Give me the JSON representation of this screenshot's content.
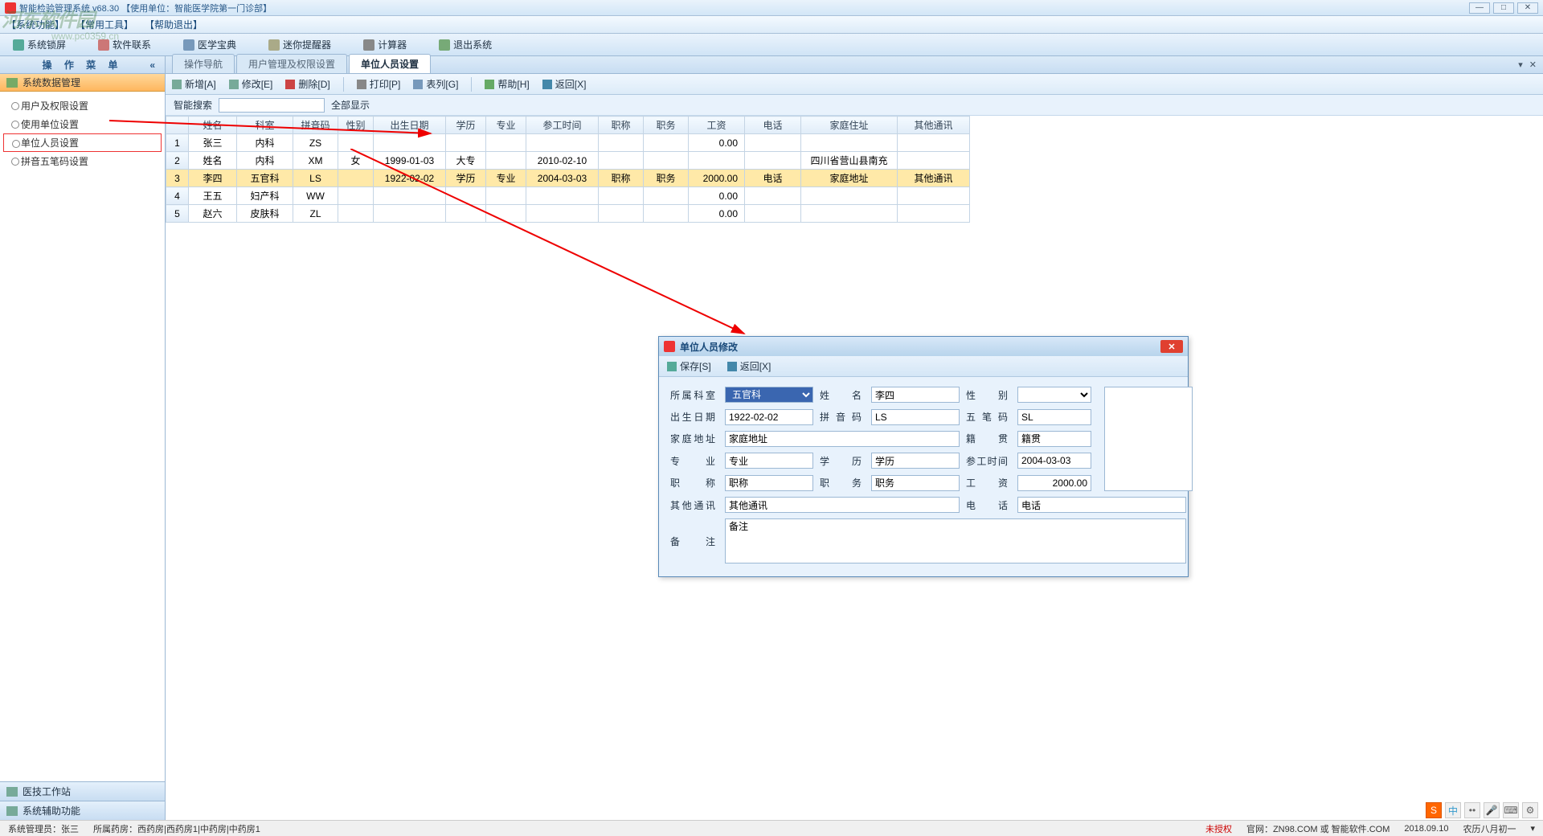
{
  "titlebar": {
    "text": "智能检验管理系统 v68.30   【使用单位：智能医学院第一门诊部】"
  },
  "menubar": {
    "items": [
      "【系统功能】",
      "【常用工具】",
      "【帮助退出】"
    ]
  },
  "maintoolbar": {
    "items": [
      "系统锁屏",
      "软件联系",
      "医学宝典",
      "迷你提醒器",
      "计算器",
      "退出系统"
    ]
  },
  "sidebar": {
    "header": "操 作 菜 单",
    "section": "系统数据管理",
    "tree": [
      "用户及权限设置",
      "使用单位设置",
      "单位人员设置",
      "拼音五笔码设置"
    ],
    "selected_index": 2,
    "bottom": [
      "医技工作站",
      "系统辅助功能"
    ]
  },
  "tabs": {
    "items": [
      "操作导航",
      "用户管理及权限设置",
      "单位人员设置"
    ],
    "active": 2
  },
  "subtoolbar": {
    "items": [
      "新增[A]",
      "修改[E]",
      "删除[D]",
      "打印[P]",
      "表列[G]",
      "帮助[H]",
      "返回[X]"
    ]
  },
  "search": {
    "label": "智能搜索",
    "value": "",
    "show_all": "全部显示"
  },
  "table": {
    "headers": [
      "",
      "姓名",
      "科室",
      "拼音码",
      "性别",
      "出生日期",
      "学历",
      "专业",
      "参工时间",
      "职称",
      "职务",
      "工资",
      "电话",
      "家庭住址",
      "其他通讯"
    ],
    "rows": [
      {
        "n": "1",
        "name": "张三",
        "dept": "内科",
        "py": "ZS",
        "sex": "",
        "birth": "",
        "edu": "",
        "spec": "",
        "work": "",
        "title": "",
        "duty": "",
        "salary": "0.00",
        "tel": "",
        "addr": "",
        "other": ""
      },
      {
        "n": "2",
        "name": "姓名",
        "dept": "内科",
        "py": "XM",
        "sex": "女",
        "birth": "1999-01-03",
        "edu": "大专",
        "spec": "",
        "work": "2010-02-10",
        "title": "",
        "duty": "",
        "salary": "",
        "tel": "",
        "addr": "四川省营山县南充",
        "other": ""
      },
      {
        "n": "3",
        "name": "李四",
        "dept": "五官科",
        "py": "LS",
        "sex": "",
        "birth": "1922-02-02",
        "edu": "学历",
        "spec": "专业",
        "work": "2004-03-03",
        "title": "职称",
        "duty": "职务",
        "salary": "2000.00",
        "tel": "电话",
        "addr": "家庭地址",
        "other": "其他通讯"
      },
      {
        "n": "4",
        "name": "王五",
        "dept": "妇产科",
        "py": "WW",
        "sex": "",
        "birth": "",
        "edu": "",
        "spec": "",
        "work": "",
        "title": "",
        "duty": "",
        "salary": "0.00",
        "tel": "",
        "addr": "",
        "other": ""
      },
      {
        "n": "5",
        "name": "赵六",
        "dept": "皮肤科",
        "py": "ZL",
        "sex": "",
        "birth": "",
        "edu": "",
        "spec": "",
        "work": "",
        "title": "",
        "duty": "",
        "salary": "0.00",
        "tel": "",
        "addr": "",
        "other": ""
      }
    ],
    "selected_row": 2
  },
  "dialog": {
    "title": "单位人员修改",
    "toolbar": [
      "保存[S]",
      "返回[X]"
    ],
    "labels": {
      "dept": "所属科室",
      "name": "姓 名",
      "sex": "性 别",
      "birth": "出生日期",
      "py": "拼 音 码",
      "wb": "五 笔 码",
      "addr": "家庭地址",
      "native": "籍 贯",
      "spec": "专 业",
      "edu": "学 历",
      "work": "参工时间",
      "title": "职 称",
      "duty": "职 务",
      "salary": "工 资",
      "other": "其他通讯",
      "tel": "电 话",
      "remark": "备 注"
    },
    "values": {
      "dept": "五官科",
      "name": "李四",
      "sex": "",
      "birth": "1922-02-02",
      "py": "LS",
      "wb": "SL",
      "addr": "家庭地址",
      "native": "籍贯",
      "spec": "专业",
      "edu": "学历",
      "work": "2004-03-03",
      "title": "职称",
      "duty": "职务",
      "salary": "2000.00",
      "other": "其他通讯",
      "tel": "电话",
      "remark": "备注"
    }
  },
  "statusbar": {
    "admin": "系统管理员：张三",
    "pharmacy": "所属药房：西药房|西药房1|中药房|中药房1",
    "auth": "未授权",
    "site": "官网：ZN98.COM 或 智能软件.COM",
    "date": "2018.09.10",
    "lunar": "农历八月初一"
  },
  "watermark": {
    "big": "河东软件园",
    "small": "www.pc0359.cn"
  }
}
